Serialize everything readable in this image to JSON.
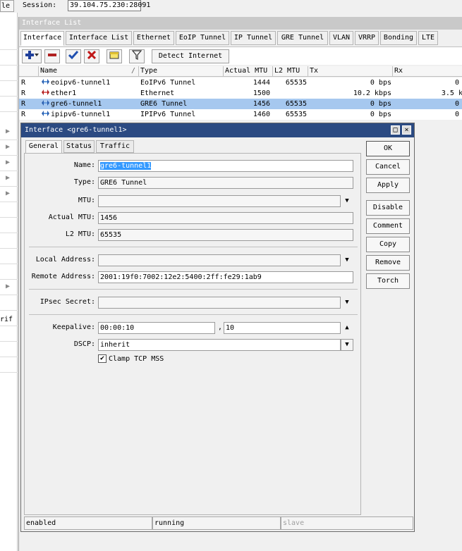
{
  "topbar": {
    "left_button_label": "le",
    "session_label": "Session:",
    "session_value": "39.104.75.230:28091"
  },
  "left_strip": {
    "cut_text": "rif"
  },
  "list_window": {
    "title": "Interface List",
    "tabs": [
      "Interface",
      "Interface List",
      "Ethernet",
      "EoIP Tunnel",
      "IP Tunnel",
      "GRE Tunnel",
      "VLAN",
      "VRRP",
      "Bonding",
      "LTE"
    ],
    "toolbar": {
      "detect_label": "Detect Internet"
    },
    "columns": [
      "Name",
      "Type",
      "Actual MTU",
      "L2 MTU",
      "Tx",
      "Rx"
    ],
    "rows": [
      {
        "flag": "R",
        "name": "eoipv6-tunnel1",
        "type": "EoIPv6 Tunnel",
        "actual_mtu": "1444",
        "l2_mtu": "65535",
        "tx": "0 bps",
        "rx": "0"
      },
      {
        "flag": "R",
        "name": "ether1",
        "type": "Ethernet",
        "actual_mtu": "1500",
        "l2_mtu": "",
        "tx": "10.2 kbps",
        "rx": "3.5 k"
      },
      {
        "flag": "R",
        "name": "gre6-tunnel1",
        "type": "GRE6 Tunnel",
        "actual_mtu": "1456",
        "l2_mtu": "65535",
        "tx": "0 bps",
        "rx": "0"
      },
      {
        "flag": "R",
        "name": "ipipv6-tunnel1",
        "type": "IPIPv6 Tunnel",
        "actual_mtu": "1460",
        "l2_mtu": "65535",
        "tx": "0 bps",
        "rx": "0"
      }
    ]
  },
  "dialog": {
    "title": "Interface <gre6-tunnel1>",
    "tabs": [
      "General",
      "Status",
      "Traffic"
    ],
    "fields": {
      "name_label": "Name:",
      "name_value": "gre6-tunnel1",
      "type_label": "Type:",
      "type_value": "GRE6 Tunnel",
      "mtu_label": "MTU:",
      "mtu_value": "",
      "actual_mtu_label": "Actual MTU:",
      "actual_mtu_value": "1456",
      "l2_mtu_label": "L2 MTU:",
      "l2_mtu_value": "65535",
      "local_address_label": "Local Address:",
      "local_address_value": "",
      "remote_address_label": "Remote Address:",
      "remote_address_value": "2001:19f0:7002:12e2:5400:2ff:fe29:1ab9",
      "ipsec_secret_label": "IPsec Secret:",
      "ipsec_secret_value": "",
      "keepalive_label": "Keepalive:",
      "keepalive_value": "00:00:10",
      "keepalive_sep": ",",
      "keepalive_retries": "10",
      "dscp_label": "DSCP:",
      "dscp_value": "inherit",
      "clamp_label": "Clamp TCP MSS",
      "clamp_checked": true
    },
    "buttons": [
      "OK",
      "Cancel",
      "Apply",
      "Disable",
      "Comment",
      "Copy",
      "Remove",
      "Torch"
    ],
    "status": [
      "enabled",
      "running",
      "slave"
    ]
  },
  "colors": {
    "title_active": "#2b4a82",
    "selection": "#a6c8ef",
    "text_selection": "#3399ff",
    "add_icon": "#1f3f9a",
    "remove_icon": "#b02020",
    "check_icon": "#1f4fb0",
    "x_icon": "#c01818"
  },
  "icons": [
    "plus-icon",
    "minus-icon",
    "check-icon",
    "x-icon",
    "note-icon",
    "filter-icon",
    "tunnel-icon",
    "ethernet-icon",
    "maximize-icon",
    "close-icon",
    "dropdown-arrow-icon",
    "up-arrow-icon",
    "checkbox-icon"
  ]
}
